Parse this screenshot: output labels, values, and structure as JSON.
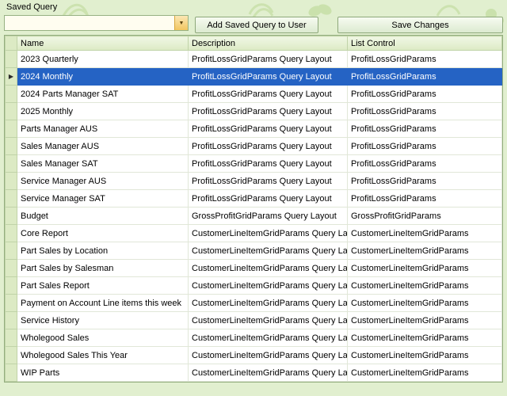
{
  "page": {
    "label": "Saved Query"
  },
  "combo": {
    "value": "",
    "placeholder": "",
    "dropdown_icon": "▼"
  },
  "buttons": {
    "add_saved_query": "Add Saved Query to User",
    "save_changes": "Save Changes"
  },
  "grid": {
    "columns": [
      "Name",
      "Description",
      "List Control"
    ],
    "selected_index": 1,
    "selection_arrow": "▶",
    "rows": [
      {
        "name": "2023 Quarterly",
        "description": "ProfitLossGridParams Query Layout",
        "list_control": "ProfitLossGridParams"
      },
      {
        "name": "2024 Monthly",
        "description": "ProfitLossGridParams Query Layout",
        "list_control": "ProfitLossGridParams"
      },
      {
        "name": "2024 Parts Manager SAT",
        "description": "ProfitLossGridParams Query Layout",
        "list_control": "ProfitLossGridParams"
      },
      {
        "name": "2025 Monthly",
        "description": "ProfitLossGridParams Query Layout",
        "list_control": "ProfitLossGridParams"
      },
      {
        "name": "Parts Manager AUS",
        "description": "ProfitLossGridParams Query Layout",
        "list_control": "ProfitLossGridParams"
      },
      {
        "name": "Sales Manager AUS",
        "description": "ProfitLossGridParams Query Layout",
        "list_control": "ProfitLossGridParams"
      },
      {
        "name": "Sales Manager SAT",
        "description": "ProfitLossGridParams Query Layout",
        "list_control": "ProfitLossGridParams"
      },
      {
        "name": "Service Manager AUS",
        "description": "ProfitLossGridParams Query Layout",
        "list_control": "ProfitLossGridParams"
      },
      {
        "name": "Service Manager SAT",
        "description": "ProfitLossGridParams Query Layout",
        "list_control": "ProfitLossGridParams"
      },
      {
        "name": "Budget",
        "description": "GrossProfitGridParams Query Layout",
        "list_control": "GrossProfitGridParams"
      },
      {
        "name": "Core Report",
        "description": "CustomerLineItemGridParams Query La...",
        "list_control": "CustomerLineItemGridParams"
      },
      {
        "name": "Part Sales by Location",
        "description": "CustomerLineItemGridParams Query La...",
        "list_control": "CustomerLineItemGridParams"
      },
      {
        "name": "Part Sales by Salesman",
        "description": "CustomerLineItemGridParams Query La...",
        "list_control": "CustomerLineItemGridParams"
      },
      {
        "name": "Part Sales Report",
        "description": "CustomerLineItemGridParams Query La...",
        "list_control": "CustomerLineItemGridParams"
      },
      {
        "name": "Payment on Account Line items this week",
        "description": "CustomerLineItemGridParams Query La...",
        "list_control": "CustomerLineItemGridParams"
      },
      {
        "name": "Service History",
        "description": "CustomerLineItemGridParams Query La...",
        "list_control": "CustomerLineItemGridParams"
      },
      {
        "name": "Wholegood Sales",
        "description": "CustomerLineItemGridParams Query La...",
        "list_control": "CustomerLineItemGridParams"
      },
      {
        "name": "Wholegood Sales This Year",
        "description": "CustomerLineItemGridParams Query La...",
        "list_control": "CustomerLineItemGridParams"
      },
      {
        "name": "WIP Parts",
        "description": "CustomerLineItemGridParams Query La...",
        "list_control": "CustomerLineItemGridParams"
      }
    ]
  },
  "colors": {
    "background": "#e1efcf",
    "header": "#dceac4",
    "selection": "#2563c4",
    "button_face": "#dcead0",
    "combo_button": "#f2c660",
    "combo_button_top": "#fbe7b4",
    "flourish": "#c7dfa6"
  }
}
